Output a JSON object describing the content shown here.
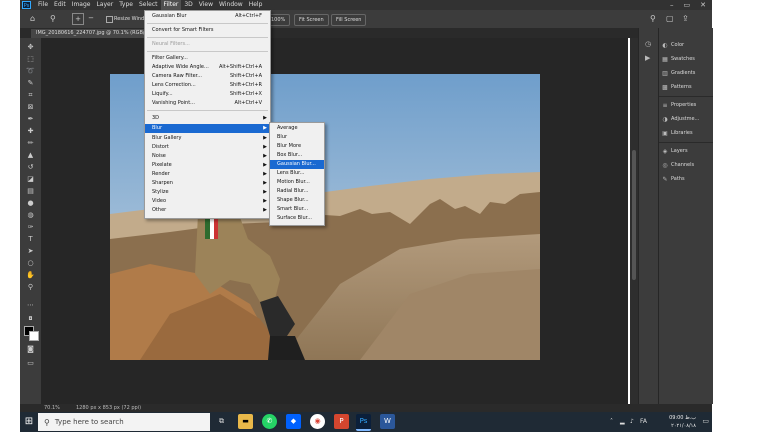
{
  "menubar": {
    "logo": "Ps",
    "items": [
      "File",
      "Edit",
      "Image",
      "Layer",
      "Type",
      "Select",
      "Filter",
      "3D",
      "View",
      "Window",
      "Help"
    ],
    "active_index": 6,
    "window_controls": [
      "–",
      "▭",
      "✕"
    ]
  },
  "optionsbar": {
    "resize_windows_label": "Resize Windows",
    "btn_100": "100%",
    "btn_fit": "Fit Screen",
    "btn_fill": "Fill Screen"
  },
  "document": {
    "tab_title": "IMG_20180616_224707.jpg @ 70.1% (RGB/8)",
    "zoom": "70.1%",
    "size_info": "1280 px x 853 px (72 ppi)"
  },
  "filter_menu": {
    "items": [
      {
        "label": "Gaussian Blur",
        "shortcut": "Alt+Ctrl+F"
      },
      {
        "sep": true
      },
      {
        "label": "Convert for Smart Filters"
      },
      {
        "sep": true
      },
      {
        "label": "Neural Filters...",
        "disabled": true
      },
      {
        "sep": true
      },
      {
        "label": "Filter Gallery..."
      },
      {
        "label": "Adaptive Wide Angle...",
        "shortcut": "Alt+Shift+Ctrl+A"
      },
      {
        "label": "Camera Raw Filter...",
        "shortcut": "Shift+Ctrl+A"
      },
      {
        "label": "Lens Correction...",
        "shortcut": "Shift+Ctrl+R"
      },
      {
        "label": "Liquify...",
        "shortcut": "Shift+Ctrl+X"
      },
      {
        "label": "Vanishing Point...",
        "shortcut": "Alt+Ctrl+V"
      },
      {
        "sep": true
      },
      {
        "label": "3D",
        "submenu": true
      },
      {
        "label": "Blur",
        "submenu": true,
        "highlight": true
      },
      {
        "label": "Blur Gallery",
        "submenu": true
      },
      {
        "label": "Distort",
        "submenu": true
      },
      {
        "label": "Noise",
        "submenu": true
      },
      {
        "label": "Pixelate",
        "submenu": true
      },
      {
        "label": "Render",
        "submenu": true
      },
      {
        "label": "Sharpen",
        "submenu": true
      },
      {
        "label": "Stylize",
        "submenu": true
      },
      {
        "label": "Video",
        "submenu": true
      },
      {
        "label": "Other",
        "submenu": true
      }
    ]
  },
  "blur_submenu": {
    "items": [
      {
        "label": "Average"
      },
      {
        "label": "Blur"
      },
      {
        "label": "Blur More"
      },
      {
        "label": "Box Blur..."
      },
      {
        "label": "Gaussian Blur...",
        "highlight": true
      },
      {
        "label": "Lens Blur..."
      },
      {
        "label": "Motion Blur..."
      },
      {
        "label": "Radial Blur..."
      },
      {
        "label": "Shape Blur..."
      },
      {
        "label": "Smart Blur..."
      },
      {
        "label": "Surface Blur..."
      }
    ]
  },
  "panels": {
    "groups": [
      [
        {
          "icon": "color-icon",
          "label": "Color"
        },
        {
          "icon": "swatches-icon",
          "label": "Swatches"
        },
        {
          "icon": "gradients-icon",
          "label": "Gradients"
        },
        {
          "icon": "patterns-icon",
          "label": "Patterns"
        }
      ],
      [
        {
          "icon": "properties-icon",
          "label": "Properties"
        },
        {
          "icon": "adjustments-icon",
          "label": "Adjustme..."
        },
        {
          "icon": "libraries-icon",
          "label": "Libraries"
        }
      ],
      [
        {
          "icon": "layers-icon",
          "label": "Layers"
        },
        {
          "icon": "channels-icon",
          "label": "Channels"
        },
        {
          "icon": "paths-icon",
          "label": "Paths"
        }
      ]
    ]
  },
  "taskbar": {
    "search_placeholder": "Type here to search",
    "time": "09:00 ب.ظ",
    "date": "۲۰۲۱/۰۸/۱۸",
    "lang": "FA"
  },
  "colors": {
    "ps_dark": "#323232",
    "menu_highlight": "#1a69d1",
    "taskbar": "#1f2a35"
  }
}
